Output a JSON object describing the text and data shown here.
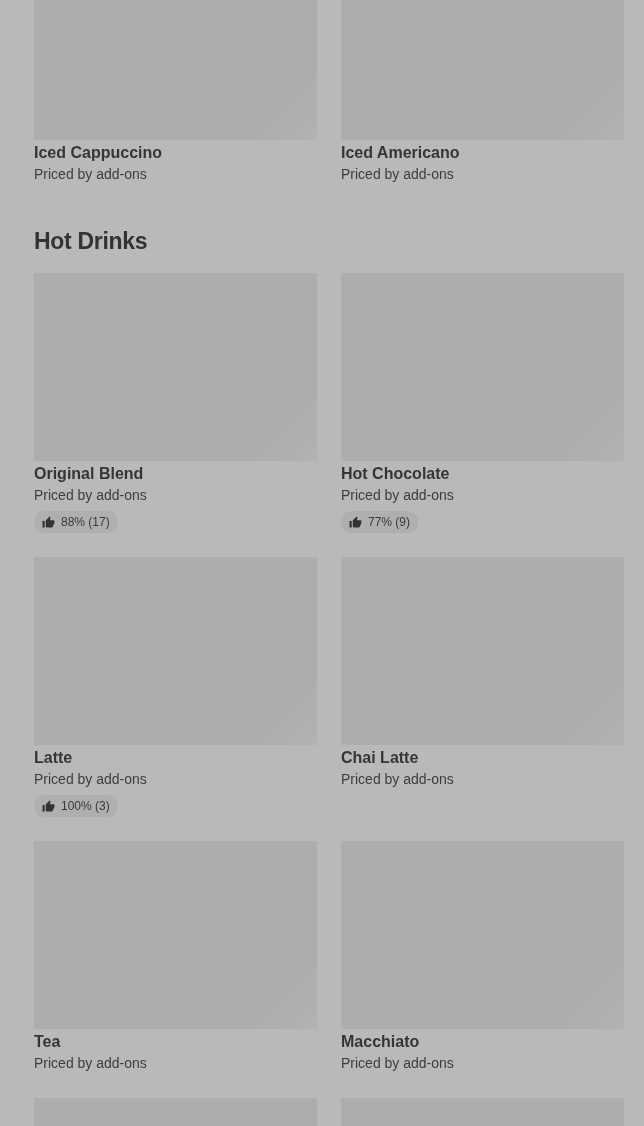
{
  "sections": [
    {
      "items": [
        {
          "kind": "product",
          "name": "Iced Cappuccino",
          "subtitle": "Priced by add-ons"
        },
        {
          "kind": "product",
          "name": "Iced Americano",
          "subtitle": "Priced by add-ons"
        }
      ]
    },
    {
      "title": "Hot Drinks",
      "items": [
        {
          "kind": "product",
          "name": "Original Blend",
          "subtitle": "Priced by add-ons",
          "rating": "88% (17)"
        },
        {
          "kind": "product",
          "name": "Hot Chocolate",
          "subtitle": "Priced by add-ons",
          "rating": "77% (9)"
        },
        {
          "kind": "product",
          "name": "Latte",
          "subtitle": "Priced by add-ons",
          "rating": "100% (3)"
        },
        {
          "kind": "product",
          "name": "Chai Latte",
          "subtitle": "Priced by add-ons"
        },
        {
          "kind": "product",
          "name": "Tea",
          "subtitle": "Priced by add-ons"
        },
        {
          "kind": "product",
          "name": "Macchiato",
          "subtitle": "Priced by add-ons"
        },
        {
          "kind": "image-only"
        },
        {
          "kind": "image-only"
        }
      ]
    }
  ]
}
